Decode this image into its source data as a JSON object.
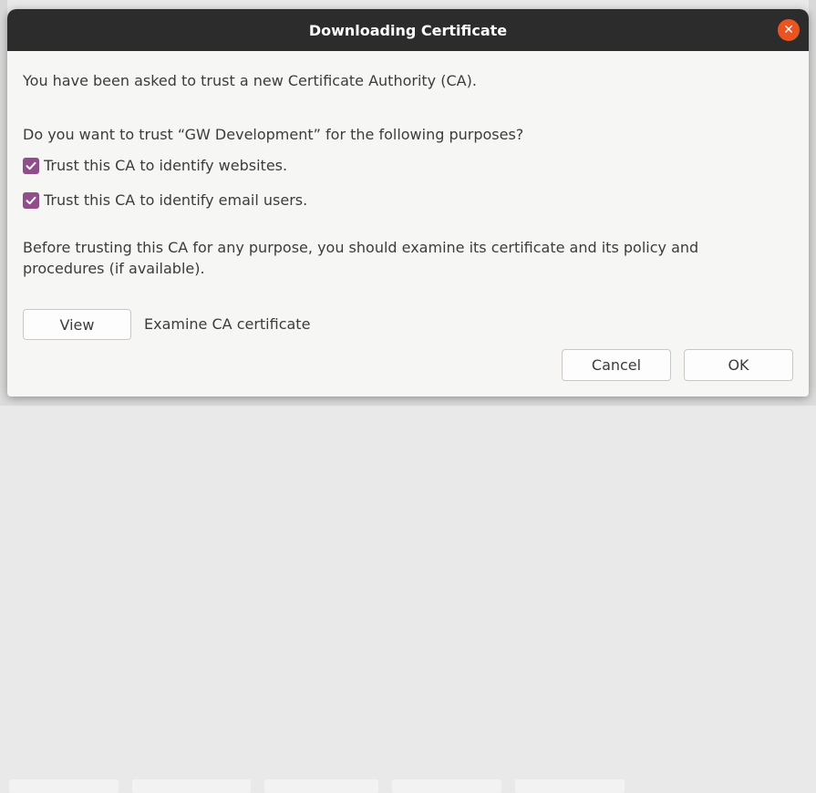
{
  "dialog": {
    "title": "Downloading Certificate",
    "close_glyph": "✕",
    "intro": "You have been asked to trust a new Certificate Authority (CA).",
    "question": "Do you want to trust “GW Development” for the following purposes?",
    "options": [
      {
        "label": "Trust this CA to identify websites.",
        "checked": true
      },
      {
        "label": "Trust this CA to identify email users.",
        "checked": true
      }
    ],
    "warning": "Before trusting this CA for any purpose, you should examine its certificate and its policy and procedures (if available).",
    "view_button": "View",
    "examine_label": "Examine CA certificate",
    "cancel_button": "Cancel",
    "ok_button": "OK"
  },
  "colors": {
    "titlebar": "#2c2c2c",
    "close_button": "#e95420",
    "checkbox_accent": "#924d8b",
    "dialog_bg": "#f6f6f5"
  }
}
